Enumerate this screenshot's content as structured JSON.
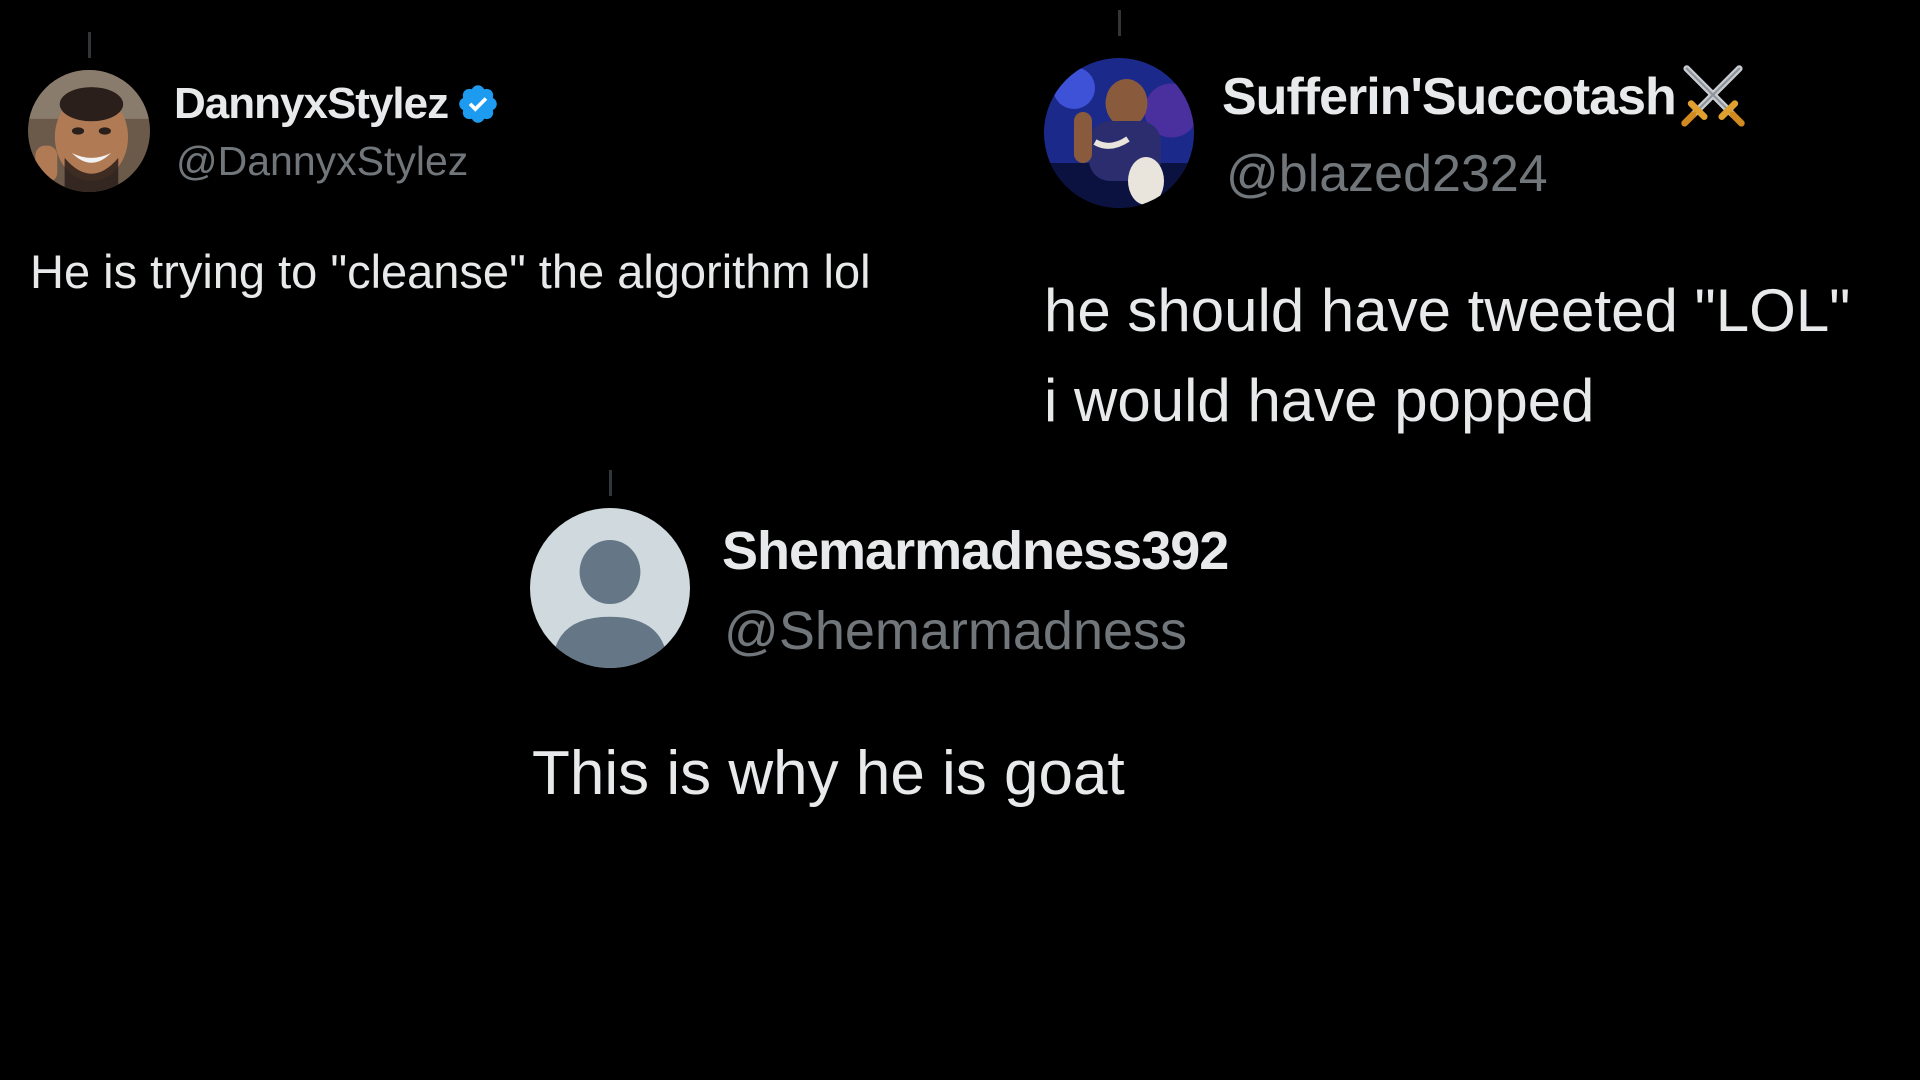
{
  "tweets": [
    {
      "display_name": "DannyxStylez",
      "handle": "@DannyxStylez",
      "verified": true,
      "badge_icon": "verified-check-icon",
      "badge_color": "#1d9bf0",
      "text_lines": [
        "He is trying to \"cleanse\" the algorithm lol"
      ]
    },
    {
      "display_name": "Sufferin'Succotash",
      "handle": "@blazed2324",
      "name_emoji": "crossed-swords-icon",
      "text_lines": [
        "he should have tweeted \"LOL\"",
        "i would have popped"
      ]
    },
    {
      "display_name": "Shemarmadness392",
      "handle": "@Shemarmadness",
      "avatar": "default-profile-icon",
      "text_lines": [
        "This is why he is goat"
      ]
    }
  ],
  "colors": {
    "background": "#000000",
    "text": "#e7e9ea",
    "handle": "#71767b",
    "thread_line": "#333639"
  }
}
